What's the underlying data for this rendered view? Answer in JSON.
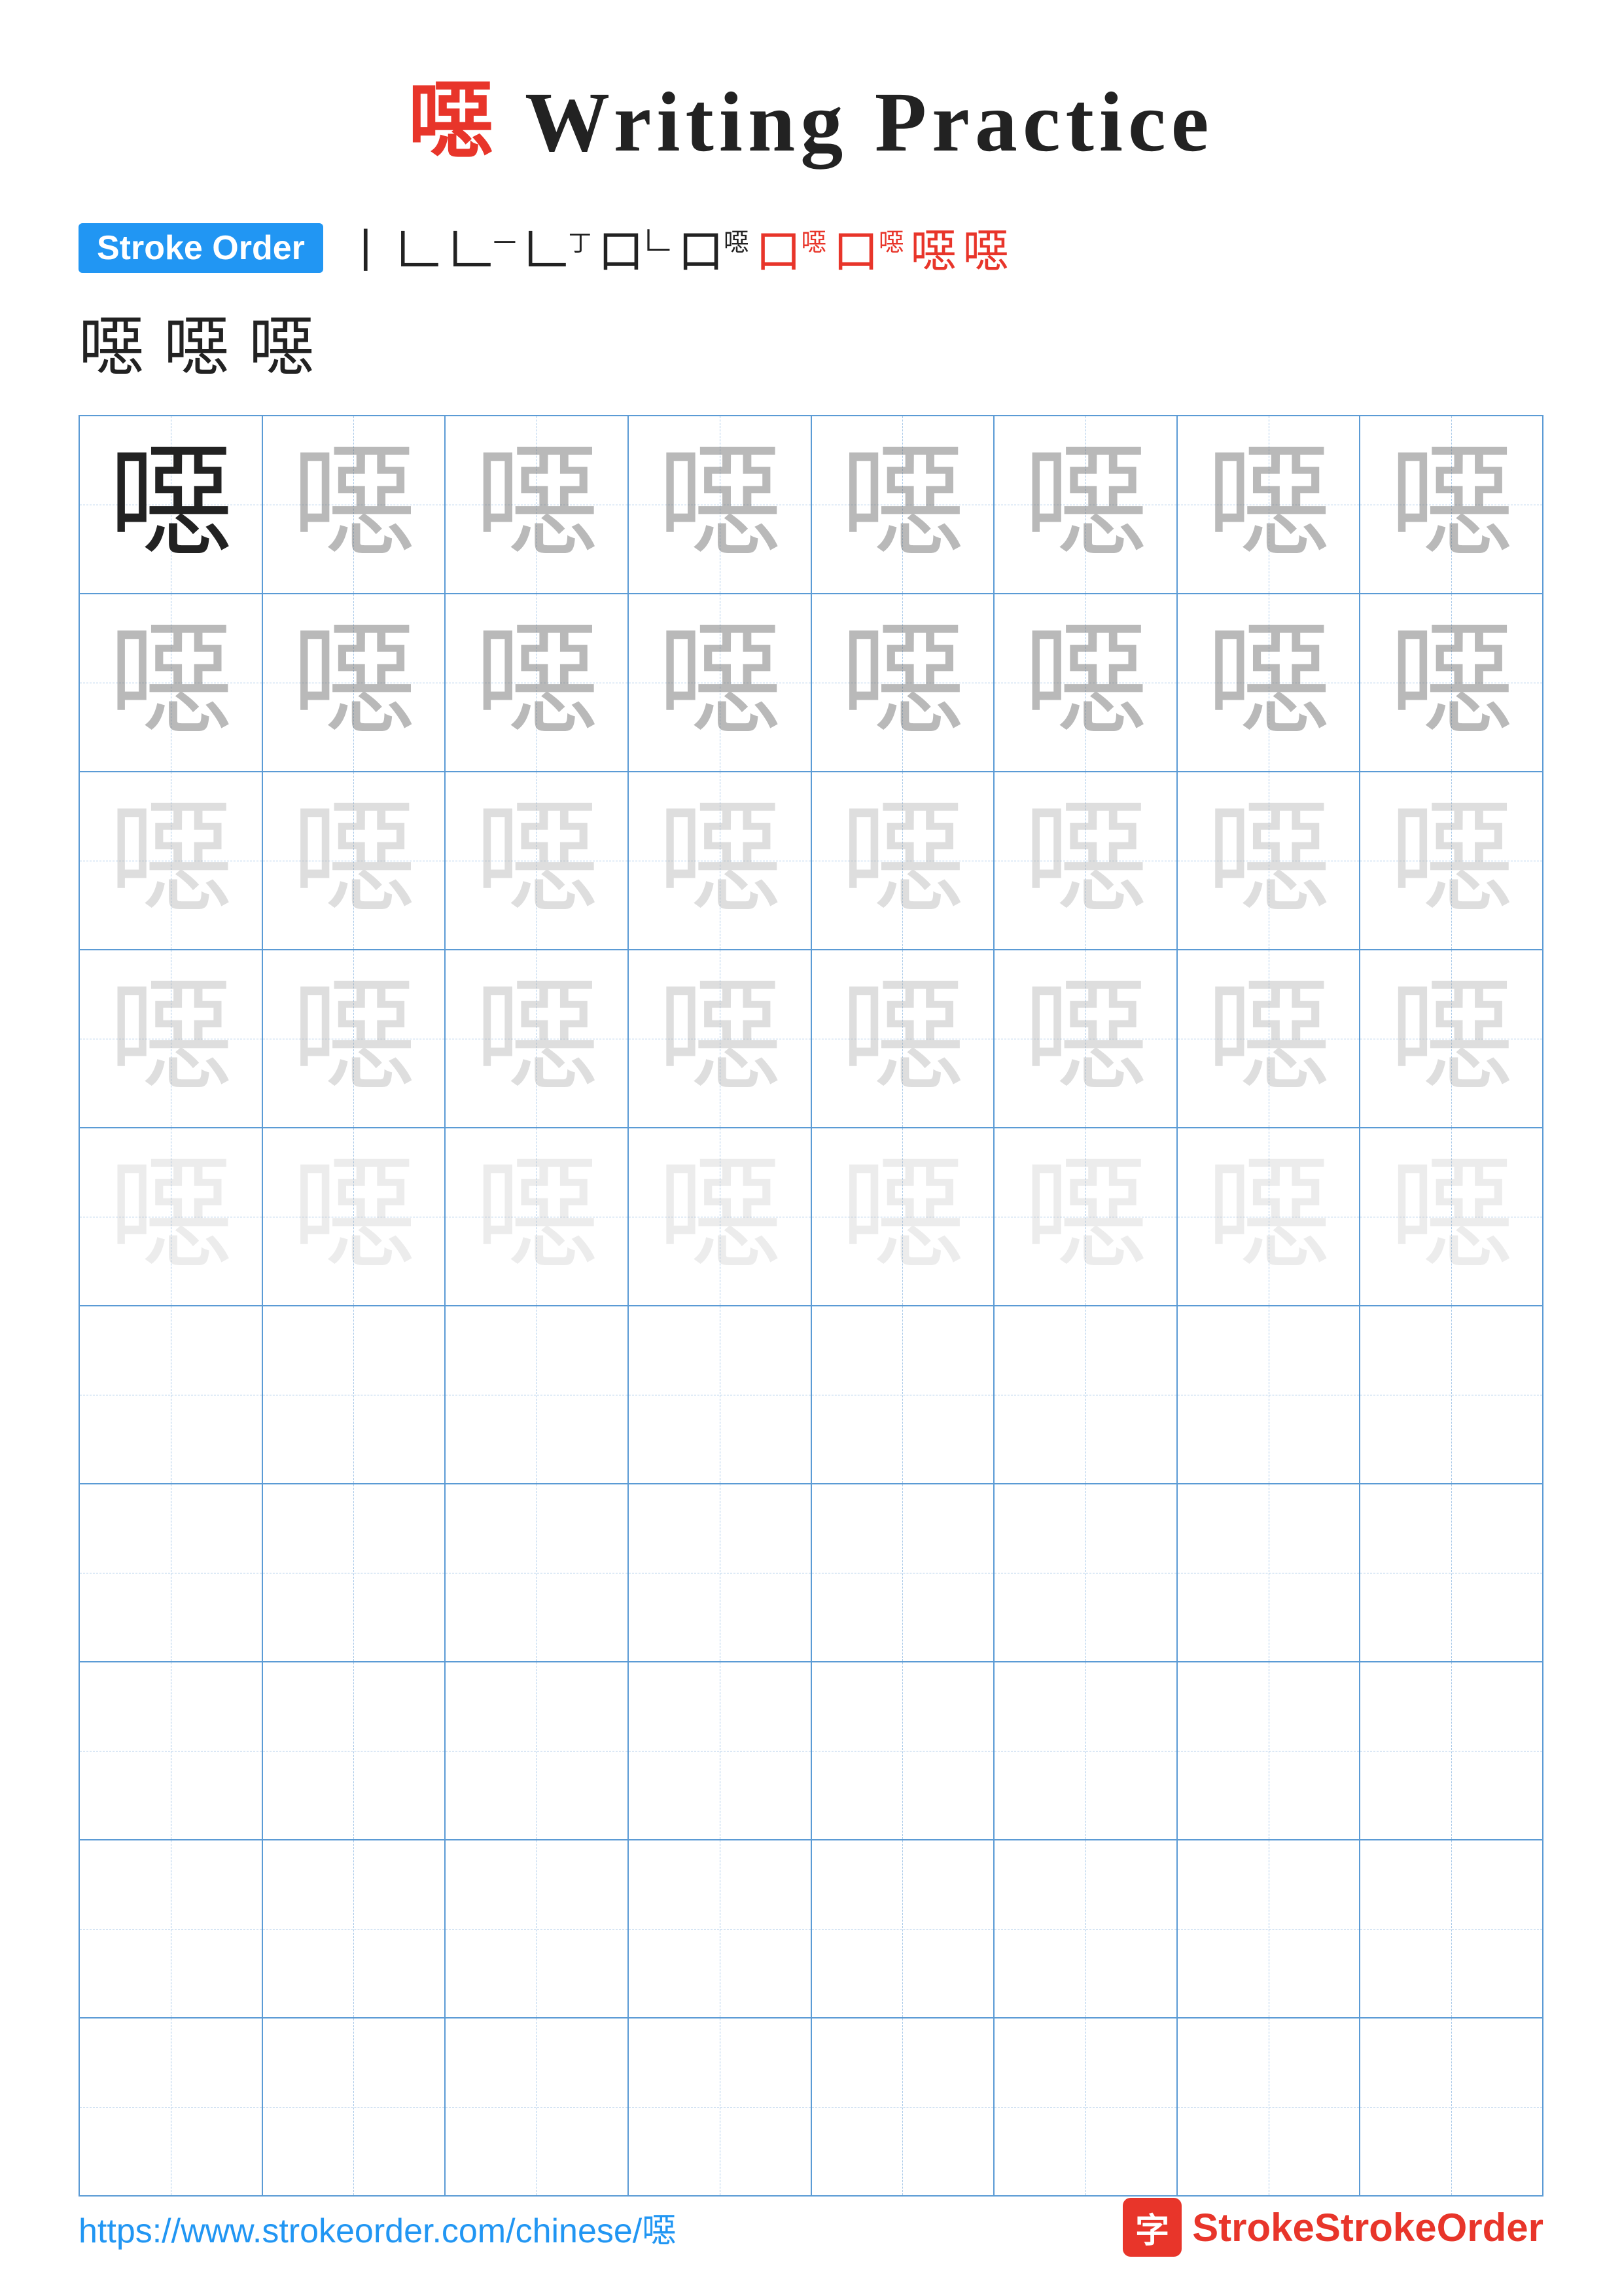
{
  "title": {
    "char": "噁",
    "text": " Writing Practice"
  },
  "stroke_order": {
    "badge_label": "Stroke Order",
    "steps": [
      "丨",
      "𠃊",
      "𠃊一",
      "𠃊丁",
      "𠃊𠃊",
      "口𠃊",
      "口𠃊",
      "口噁",
      "口噁",
      "噁",
      "噁"
    ],
    "examples": [
      "噁",
      "噁",
      "噁"
    ]
  },
  "grid": {
    "rows": 10,
    "cols": 8,
    "practice_char": "噁",
    "filled_rows": 5,
    "empty_rows": 5
  },
  "footer": {
    "url": "https://www.strokeorder.com/chinese/噁",
    "logo_char": "字",
    "logo_text": "StrokeOrder"
  }
}
